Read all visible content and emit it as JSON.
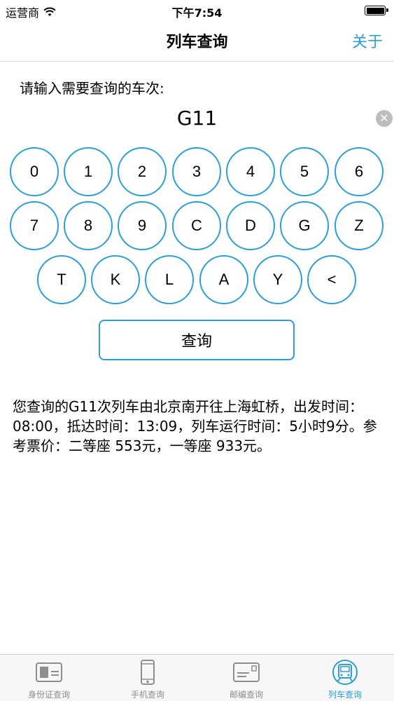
{
  "status_bar": {
    "carrier": "运营商",
    "time": "下午7:54"
  },
  "nav": {
    "title": "列车查询",
    "about": "关于"
  },
  "input": {
    "prompt": "请输入需要查询的车次:",
    "value": "G11"
  },
  "keypad": {
    "row1": [
      "0",
      "1",
      "2",
      "3",
      "4",
      "5",
      "6"
    ],
    "row2": [
      "7",
      "8",
      "9",
      "C",
      "D",
      "G",
      "Z"
    ],
    "row3": [
      "T",
      "K",
      "L",
      "A",
      "Y",
      "<"
    ]
  },
  "query_button": "查询",
  "result": "您查询的G11次列车由北京南开往上海虹桥，出发时间：08:00，抵达时间：13:09，列车运行时间：5小时9分。参考票价：二等座 553元，一等座 933元。",
  "tabs": [
    {
      "label": "身份证查询",
      "icon": "id-card-icon"
    },
    {
      "label": "手机查询",
      "icon": "phone-icon"
    },
    {
      "label": "邮编查询",
      "icon": "envelope-icon"
    },
    {
      "label": "列车查询",
      "icon": "train-icon",
      "active": true
    }
  ],
  "colors": {
    "accent": "#2a9fd8",
    "tab_inactive": "#8e8e8e"
  }
}
